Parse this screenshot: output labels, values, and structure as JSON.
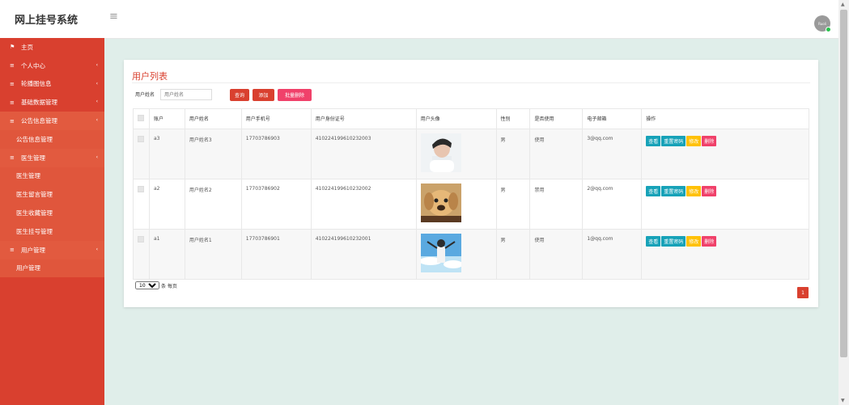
{
  "app": {
    "title": "网上挂号系统",
    "toggle_icon": "≡"
  },
  "user": {
    "avatar_text": "Ruoli"
  },
  "sidebar": {
    "items": [
      {
        "label": "主页",
        "icon": "flag-icon",
        "type": "parent",
        "has_arrow": false
      },
      {
        "label": "个人中心",
        "icon": "menu-icon",
        "type": "parent",
        "has_arrow": true
      },
      {
        "label": "轮播图信息",
        "icon": "menu-icon",
        "type": "parent",
        "has_arrow": true
      },
      {
        "label": "基础数据管理",
        "icon": "menu-icon",
        "type": "parent",
        "has_arrow": true
      },
      {
        "label": "公告信息管理",
        "icon": "menu-icon",
        "type": "parent",
        "has_arrow": true,
        "active": true
      },
      {
        "label": "公告信息管理",
        "type": "child"
      },
      {
        "label": "医生管理",
        "icon": "menu-icon",
        "type": "parent",
        "has_arrow": true,
        "active": true
      },
      {
        "label": "医生管理",
        "type": "child"
      },
      {
        "label": "医生留言管理",
        "type": "child"
      },
      {
        "label": "医生收藏管理",
        "type": "child"
      },
      {
        "label": "医生挂号管理",
        "type": "child"
      },
      {
        "label": "用户管理",
        "icon": "menu-icon",
        "type": "parent",
        "has_arrow": true,
        "active": true
      },
      {
        "label": "用户管理",
        "type": "child"
      }
    ]
  },
  "panel": {
    "title": "用户列表",
    "search": {
      "label": "用户姓名",
      "placeholder": "用户姓名"
    },
    "buttons": {
      "query": "查询",
      "add": "添加",
      "batch_delete": "批量删除"
    }
  },
  "table": {
    "headers": [
      "账户",
      "用户姓名",
      "用户手机号",
      "用户身份证号",
      "用户头像",
      "性别",
      "是否使用",
      "电子邮箱",
      "操作"
    ],
    "rows": [
      {
        "account": "a3",
        "name": "用户姓名3",
        "phone": "17703786903",
        "idcard": "410224199610232003",
        "avatar": "portrait-photo",
        "gender": "男",
        "status": "使用",
        "email": "3@qq.com"
      },
      {
        "account": "a2",
        "name": "用户姓名2",
        "phone": "17703786902",
        "idcard": "410224199610232002",
        "avatar": "puppy-photo",
        "gender": "男",
        "status": "禁用",
        "email": "2@qq.com"
      },
      {
        "account": "a1",
        "name": "用户姓名1",
        "phone": "17703786901",
        "idcard": "410224199610232001",
        "avatar": "sky-photo",
        "gender": "男",
        "status": "使用",
        "email": "1@qq.com"
      }
    ],
    "actions": {
      "view": "查看",
      "reset": "重置密码",
      "edit": "修改",
      "delete": "删除"
    }
  },
  "pagination": {
    "page_size": "10",
    "page_size_suffix": "条 每页",
    "current_page": "1"
  },
  "colors": {
    "brand": "#d9402f",
    "content_bg": "#e0eeea",
    "view": "#17a2b8",
    "edit": "#ffc107",
    "delete": "#f0416a"
  }
}
